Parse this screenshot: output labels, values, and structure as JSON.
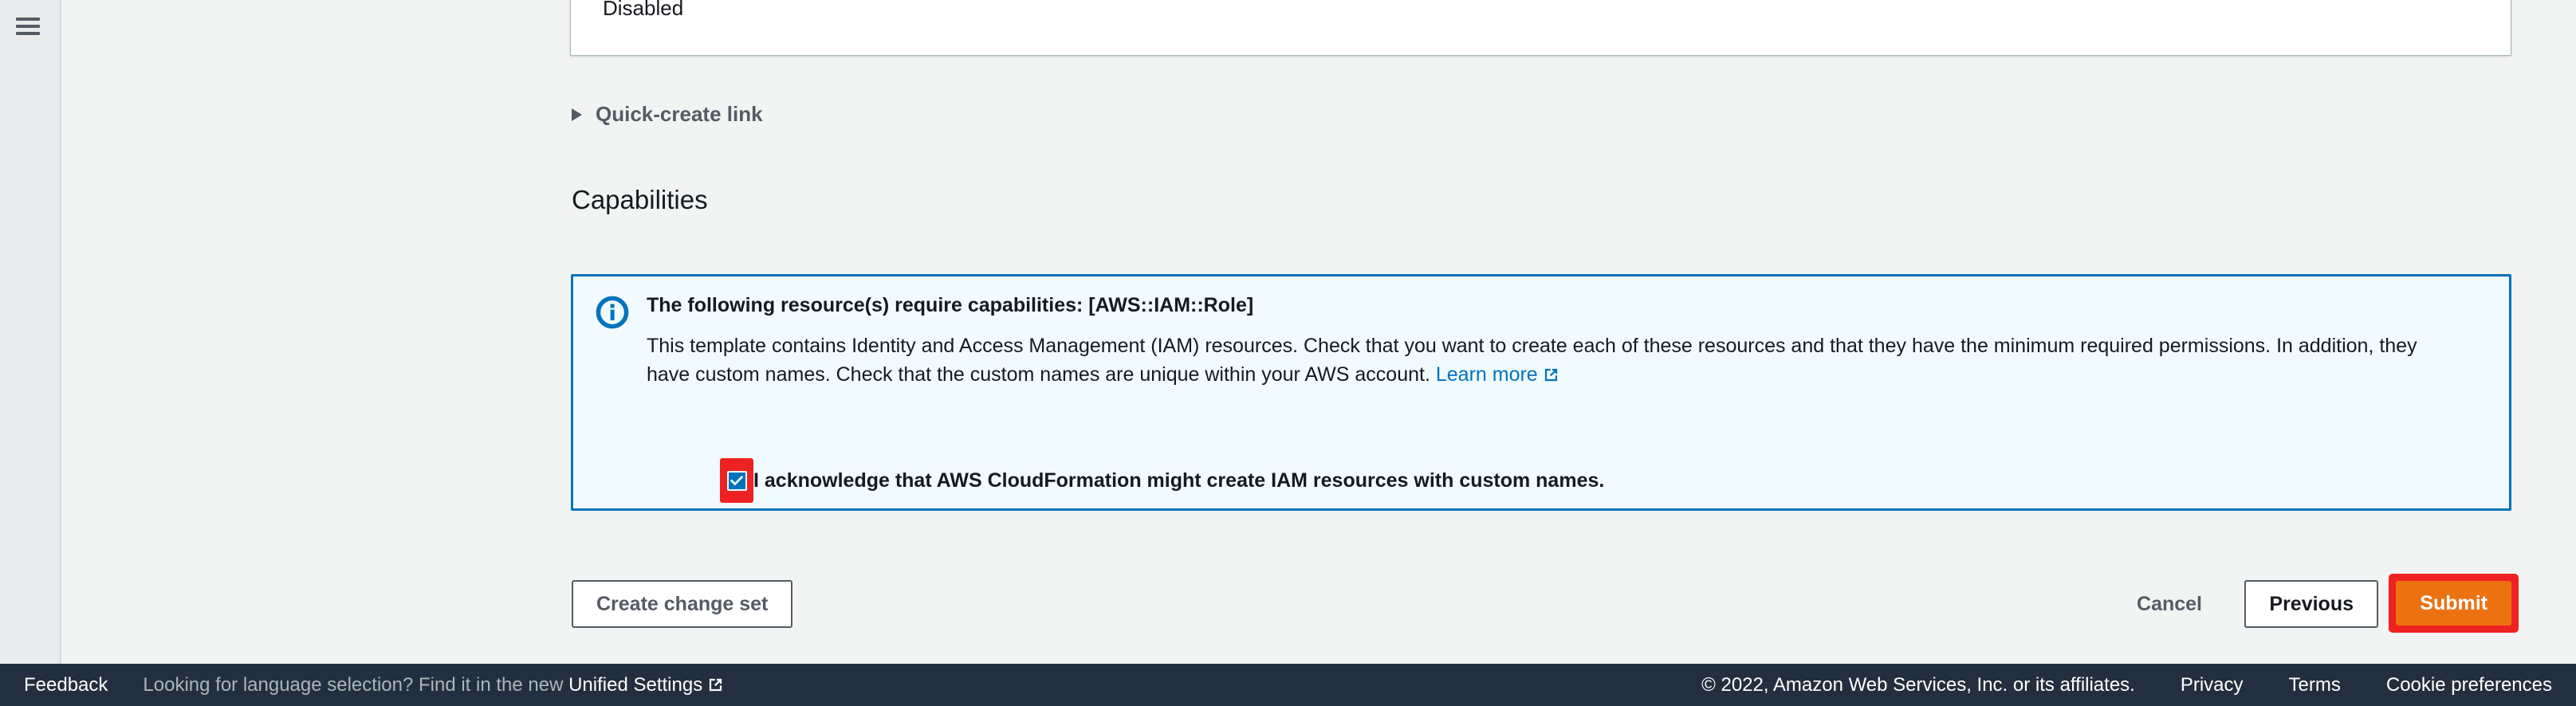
{
  "sidebar": {
    "menu_icon": "hamburger-menu-icon"
  },
  "top_panel": {
    "value": "Disabled"
  },
  "quick_create": {
    "label": "Quick-create link",
    "caret_icon": "triangle-right-icon",
    "expanded": false
  },
  "capabilities": {
    "heading": "Capabilities",
    "alert": {
      "icon": "info-circle-icon",
      "title": "The following resource(s) require capabilities: [AWS::IAM::Role]",
      "body_before_link": "This template contains Identity and Access Management (IAM) resources. Check that you want to create each of these resources and that they have the minimum required permissions. In addition, they have custom names. Check that the custom names are unique within your AWS account.",
      "link_label": "Learn more",
      "link_icon": "external-link-icon"
    },
    "acknowledge": {
      "label": "I acknowledge that AWS CloudFormation might create IAM resources with custom names.",
      "checked": true,
      "highlight_color": "#ee2222",
      "check_color": "#0073bb"
    }
  },
  "actions": {
    "create_change_set_label": "Create change set",
    "cancel_label": "Cancel",
    "previous_label": "Previous",
    "submit_label": "Submit",
    "submit_color": "#ec7211",
    "submit_highlight_color": "#ee2222"
  },
  "footer": {
    "feedback_label": "Feedback",
    "language_note_prefix": "Looking for language selection? Find it in the new ",
    "unified_settings_label": "Unified Settings",
    "unified_settings_icon": "external-link-icon",
    "copyright": "© 2022, Amazon Web Services, Inc. or its affiliates.",
    "privacy_label": "Privacy",
    "terms_label": "Terms",
    "cookie_preferences_label": "Cookie preferences"
  },
  "colors": {
    "page_background": "#f2f3f3",
    "sidebar_background": "#e9ebed",
    "alert_background": "#f1faff",
    "alert_border": "#0073bb",
    "footer_background": "#232f3e",
    "link": "#0073bb"
  }
}
